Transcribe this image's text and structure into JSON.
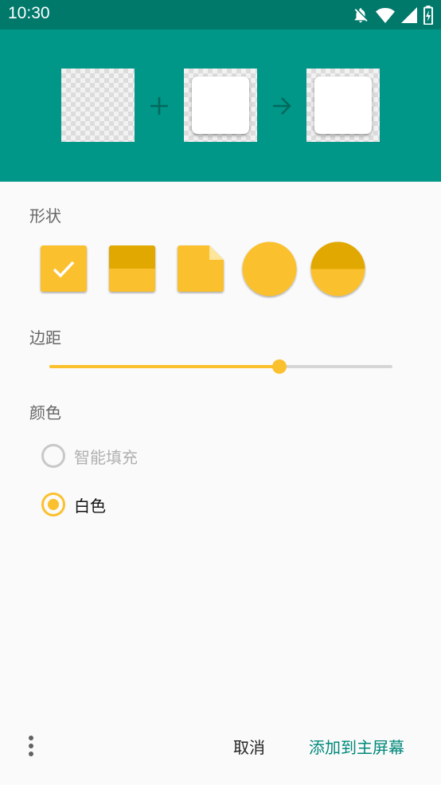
{
  "status_bar": {
    "time": "10:30",
    "icons": [
      "notifications-off-icon",
      "wifi-icon",
      "signal-icon",
      "battery-icon"
    ]
  },
  "preview": {
    "operators": [
      "plus-icon",
      "arrow-right-icon"
    ]
  },
  "shape_section": {
    "label": "形状",
    "options": [
      {
        "name": "rounded-square",
        "selected": true
      },
      {
        "name": "square-two-tone",
        "selected": false
      },
      {
        "name": "folded-corner",
        "selected": false
      },
      {
        "name": "circle",
        "selected": false
      },
      {
        "name": "circle-two-tone",
        "selected": false
      }
    ]
  },
  "padding_section": {
    "label": "边距",
    "slider_value": 0.67
  },
  "color_section": {
    "label": "颜色",
    "options": [
      {
        "label": "智能填充",
        "checked": false,
        "enabled": false
      },
      {
        "label": "白色",
        "checked": true,
        "enabled": true
      }
    ]
  },
  "bottom_bar": {
    "more_icon": "more-vert-icon",
    "cancel_label": "取消",
    "add_label": "添加到主屏幕"
  },
  "colors": {
    "status_bar": "#00796b",
    "header": "#009688",
    "accent": "#fbc02d",
    "accent_dark": "#e0a800",
    "action_text": "#00897b"
  }
}
